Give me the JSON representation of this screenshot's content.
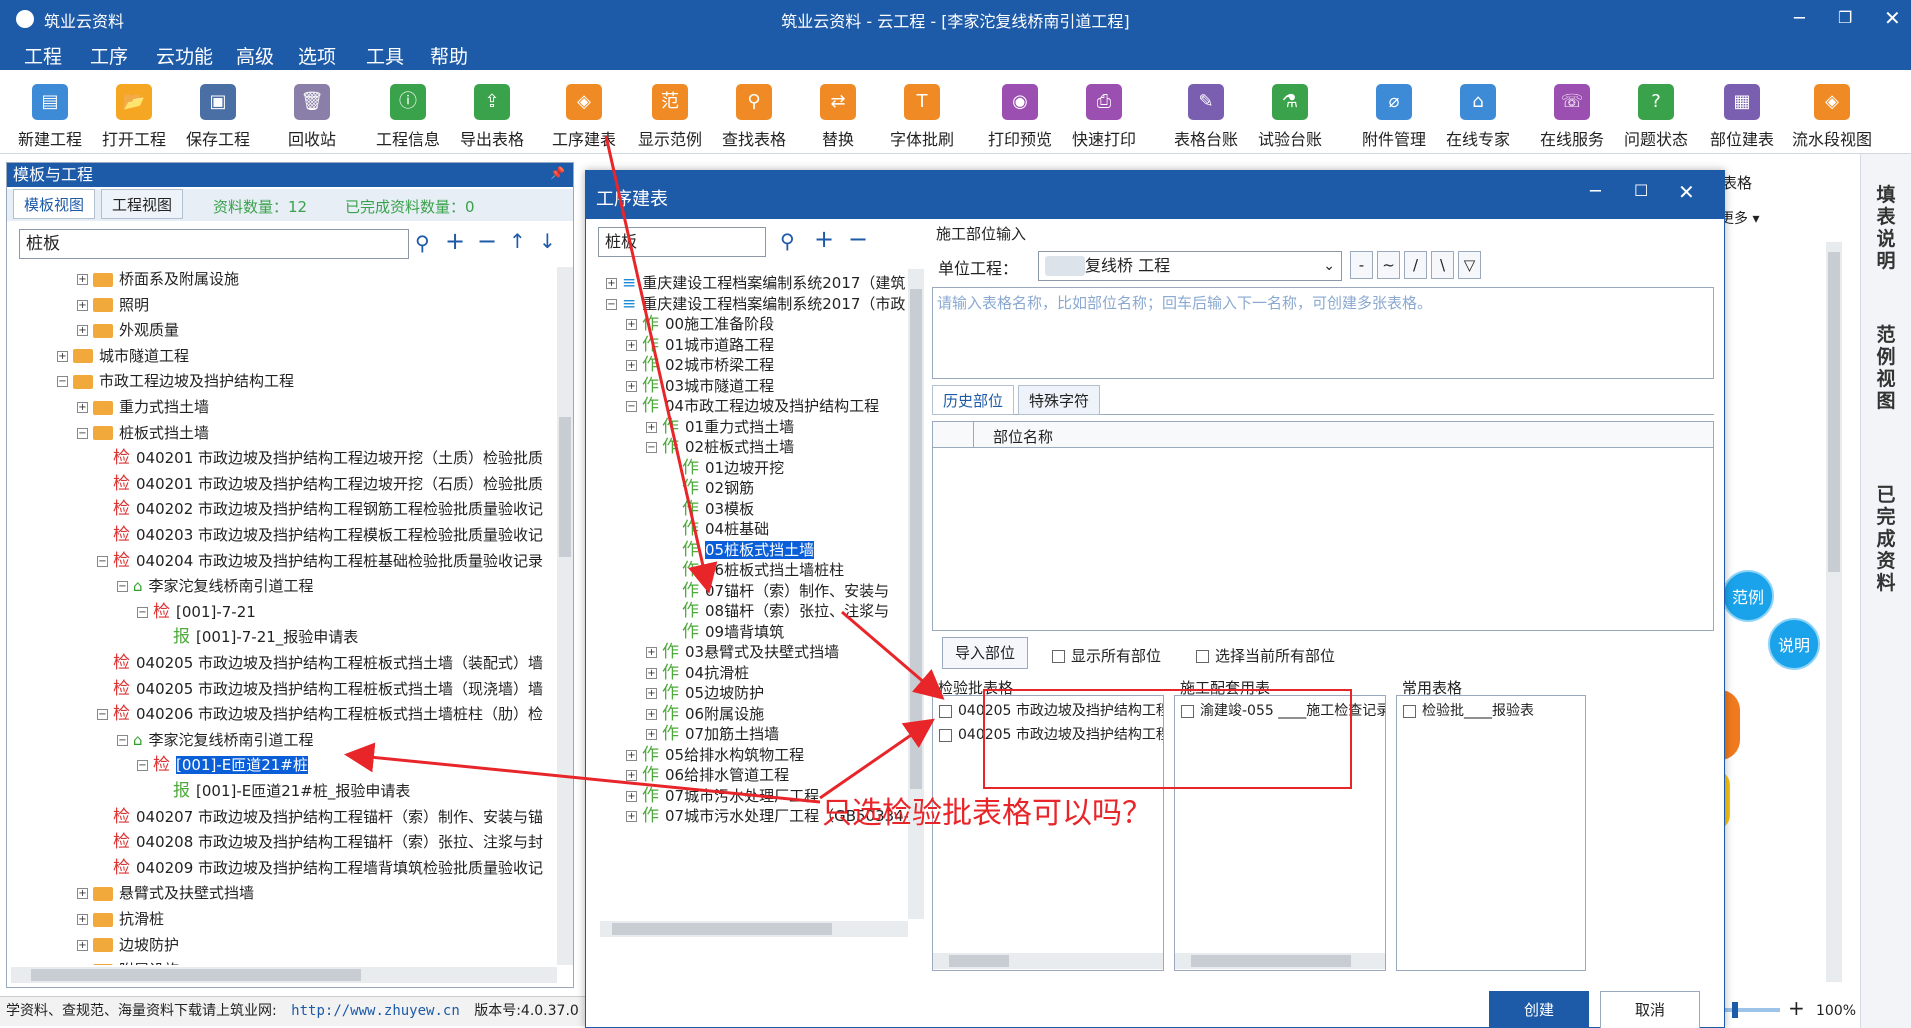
{
  "window": {
    "app_name": "筑业云资料",
    "title": "筑业云资料 - 云工程 - [李家沱复线桥南引道工程]"
  },
  "menu": [
    "工程",
    "工序",
    "云功能",
    "高级",
    "选项",
    "工具",
    "帮助"
  ],
  "toolbar": [
    {
      "label": "新建工程",
      "icon": "new-doc-icon",
      "color": "#3d8ad6"
    },
    {
      "label": "打开工程",
      "icon": "folder-open-icon",
      "color": "#f5a623"
    },
    {
      "label": "保存工程",
      "icon": "save-icon",
      "color": "#4a6fa5"
    },
    {
      "label": "回收站",
      "icon": "trash-icon",
      "color": "#8a7fa8"
    },
    {
      "label": "工程信息",
      "icon": "info-icon",
      "color": "#3aa24a"
    },
    {
      "label": "导出表格",
      "icon": "export-icon",
      "color": "#3aa24a"
    },
    {
      "label": "工序建表",
      "icon": "layers-icon",
      "color": "#f08a24"
    },
    {
      "label": "显示范例",
      "icon": "example-icon",
      "color": "#f08a24"
    },
    {
      "label": "查找表格",
      "icon": "search-icon",
      "color": "#f08a24"
    },
    {
      "label": "替换",
      "icon": "replace-icon",
      "color": "#f08a24"
    },
    {
      "label": "字体批刷",
      "icon": "font-brush-icon",
      "color": "#f08a24"
    },
    {
      "label": "打印预览",
      "icon": "eye-icon",
      "color": "#9b4fb0"
    },
    {
      "label": "快速打印",
      "icon": "printer-icon",
      "color": "#9b4fb0"
    },
    {
      "label": "表格台账",
      "icon": "ledger-icon",
      "color": "#7a5fb0"
    },
    {
      "label": "试验台账",
      "icon": "test-ledger-icon",
      "color": "#3aa24a"
    },
    {
      "label": "附件管理",
      "icon": "paperclip-icon",
      "color": "#3d8ad6"
    },
    {
      "label": "在线专家",
      "icon": "expert-icon",
      "color": "#3d8ad6"
    },
    {
      "label": "在线服务",
      "icon": "service-icon",
      "color": "#9b4fb0"
    },
    {
      "label": "问题状态",
      "icon": "question-icon",
      "color": "#3aa24a"
    },
    {
      "label": "部位建表",
      "icon": "grid-icon",
      "color": "#7a5fb0"
    },
    {
      "label": "流水段视图",
      "icon": "flow-icon",
      "color": "#f08a24"
    }
  ],
  "left_panel": {
    "title": "模板与工程",
    "tabs": [
      "模板视图",
      "工程视图"
    ],
    "count_label": "资料数量：12",
    "done_label": "已完成资料数量：0",
    "search_value": "桩板",
    "tree": [
      {
        "indent": 3,
        "pm": "+",
        "kind": "folder",
        "text": "桥面系及附属设施"
      },
      {
        "indent": 3,
        "pm": "+",
        "kind": "folder",
        "text": "照明"
      },
      {
        "indent": 3,
        "pm": "+",
        "kind": "folder",
        "text": "外观质量"
      },
      {
        "indent": 2,
        "pm": "+",
        "kind": "folder",
        "text": "城市隧道工程"
      },
      {
        "indent": 2,
        "pm": "-",
        "kind": "folder",
        "text": "市政工程边坡及挡护结构工程"
      },
      {
        "indent": 3,
        "pm": "+",
        "kind": "folder",
        "text": "重力式挡土墙"
      },
      {
        "indent": 3,
        "pm": "-",
        "kind": "folder",
        "text": "桩板式挡土墙"
      },
      {
        "indent": 4,
        "pm": "",
        "kind": "jian",
        "text": "040201 市政边坡及挡护结构工程边坡开挖（土质）检验批质"
      },
      {
        "indent": 4,
        "pm": "",
        "kind": "jian",
        "text": "040201 市政边坡及挡护结构工程边坡开挖（石质）检验批质"
      },
      {
        "indent": 4,
        "pm": "",
        "kind": "jian",
        "text": "040202 市政边坡及挡护结构工程钢筋工程检验批质量验收记"
      },
      {
        "indent": 4,
        "pm": "",
        "kind": "jian",
        "text": "040203 市政边坡及挡护结构工程模板工程检验批质量验收记"
      },
      {
        "indent": 4,
        "pm": "-",
        "kind": "jian",
        "text": "040204 市政边坡及挡护结构工程桩基础检验批质量验收记录"
      },
      {
        "indent": 5,
        "pm": "-",
        "kind": "house",
        "text": "李家沱复线桥南引道工程"
      },
      {
        "indent": 6,
        "pm": "-",
        "kind": "jian",
        "text": "[001]-7-21"
      },
      {
        "indent": 7,
        "pm": "",
        "kind": "bao",
        "text": "[001]-7-21_报验申请表"
      },
      {
        "indent": 4,
        "pm": "",
        "kind": "jian",
        "text": "040205 市政边坡及挡护结构工程桩板式挡土墙（装配式）墙"
      },
      {
        "indent": 4,
        "pm": "",
        "kind": "jian",
        "text": "040205 市政边坡及挡护结构工程桩板式挡土墙（现浇墙）墙"
      },
      {
        "indent": 4,
        "pm": "-",
        "kind": "jian",
        "text": "040206 市政边坡及挡护结构工程桩板式挡土墙桩柱（肋）检"
      },
      {
        "indent": 5,
        "pm": "-",
        "kind": "house",
        "text": "李家沱复线桥南引道工程"
      },
      {
        "indent": 6,
        "pm": "-",
        "kind": "jian",
        "text": "[001]-E匝道21#桩",
        "selected": true
      },
      {
        "indent": 7,
        "pm": "",
        "kind": "bao",
        "text": "[001]-E匝道21#桩_报验申请表"
      },
      {
        "indent": 4,
        "pm": "",
        "kind": "jian",
        "text": "040207 市政边坡及挡护结构工程锚杆（索）制作、安装与锚"
      },
      {
        "indent": 4,
        "pm": "",
        "kind": "jian",
        "text": "040208 市政边坡及挡护结构工程锚杆（索）张拉、注浆与封"
      },
      {
        "indent": 4,
        "pm": "",
        "kind": "jian",
        "text": "040209 市政边坡及挡护结构工程墙背填筑检验批质量验收记"
      },
      {
        "indent": 3,
        "pm": "+",
        "kind": "folder",
        "text": "悬臂式及扶壁式挡墙"
      },
      {
        "indent": 3,
        "pm": "+",
        "kind": "folder",
        "text": "抗滑桩"
      },
      {
        "indent": 3,
        "pm": "+",
        "kind": "folder",
        "text": "边坡防护"
      },
      {
        "indent": 3,
        "pm": "+",
        "kind": "folder",
        "text": "附属设施"
      }
    ]
  },
  "status_bar": {
    "text": "学资料、查规范、海量资料下载请上筑业网:",
    "url": "http://www.zhuyew.cn",
    "version": "版本号:4.0.37.0"
  },
  "dialog": {
    "title": "工序建表",
    "search_value": "桩板",
    "tree": [
      {
        "indent": 0,
        "pm": "+",
        "kind": "db",
        "text": "重庆建设工程档案编制系统2017（建筑"
      },
      {
        "indent": 0,
        "pm": "-",
        "kind": "db",
        "text": "重庆建设工程档案编制系统2017（市政"
      },
      {
        "indent": 1,
        "pm": "+",
        "kind": "zuo",
        "text": "00施工准备阶段"
      },
      {
        "indent": 1,
        "pm": "+",
        "kind": "zuo",
        "text": "01城市道路工程"
      },
      {
        "indent": 1,
        "pm": "+",
        "kind": "zuo",
        "text": "02城市桥梁工程"
      },
      {
        "indent": 1,
        "pm": "+",
        "kind": "zuo",
        "text": "03城市隧道工程"
      },
      {
        "indent": 1,
        "pm": "-",
        "kind": "zuo",
        "text": "04市政工程边坡及挡护结构工程"
      },
      {
        "indent": 2,
        "pm": "+",
        "kind": "zuo",
        "text": "01重力式挡土墙"
      },
      {
        "indent": 2,
        "pm": "-",
        "kind": "zuo",
        "text": "02桩板式挡土墙"
      },
      {
        "indent": 3,
        "pm": "",
        "kind": "zuo",
        "text": "01边坡开挖"
      },
      {
        "indent": 3,
        "pm": "",
        "kind": "zuo",
        "text": "02钢筋"
      },
      {
        "indent": 3,
        "pm": "",
        "kind": "zuo",
        "text": "03模板"
      },
      {
        "indent": 3,
        "pm": "",
        "kind": "zuo",
        "text": "04桩基础"
      },
      {
        "indent": 3,
        "pm": "",
        "kind": "zuo",
        "text": "05桩板式挡土墙",
        "selected": true
      },
      {
        "indent": 3,
        "pm": "",
        "kind": "zuo",
        "text": "06桩板式挡土墙桩柱"
      },
      {
        "indent": 3,
        "pm": "",
        "kind": "zuo",
        "text": "07锚杆（索）制作、安装与"
      },
      {
        "indent": 3,
        "pm": "",
        "kind": "zuo",
        "text": "08锚杆（索）张拉、注浆与"
      },
      {
        "indent": 3,
        "pm": "",
        "kind": "zuo",
        "text": "09墙背填筑"
      },
      {
        "indent": 2,
        "pm": "+",
        "kind": "zuo",
        "text": "03悬臂式及扶壁式挡墙"
      },
      {
        "indent": 2,
        "pm": "+",
        "kind": "zuo",
        "text": "04抗滑桩"
      },
      {
        "indent": 2,
        "pm": "+",
        "kind": "zuo",
        "text": "05边坡防护"
      },
      {
        "indent": 2,
        "pm": "+",
        "kind": "zuo",
        "text": "06附属设施"
      },
      {
        "indent": 2,
        "pm": "+",
        "kind": "zuo",
        "text": "07加筋土挡墙"
      },
      {
        "indent": 1,
        "pm": "+",
        "kind": "zuo",
        "text": "05给排水构筑物工程"
      },
      {
        "indent": 1,
        "pm": "+",
        "kind": "zuo",
        "text": "06给排水管道工程"
      },
      {
        "indent": 1,
        "pm": "+",
        "kind": "zuo",
        "text": "07城市污水处理厂工程"
      },
      {
        "indent": 1,
        "pm": "+",
        "kind": "zuo",
        "text": "07城市污水处理厂工程（GB50334-2"
      }
    ],
    "location_group": "施工部位输入",
    "unit_label": "单位工程：",
    "unit_value": "复线桥   工程",
    "sym_buttons": [
      "-",
      "~",
      "/",
      "\\",
      "▽"
    ],
    "textarea_placeholder": "请输入表格名称，比如部位名称；回车后输入下一名称，可创建多张表格。",
    "tabs": [
      "历史部位",
      "特殊字符"
    ],
    "grid_header": "部位名称",
    "import_button": "导入部位",
    "show_all_label": "显示所有部位",
    "select_all_label": "选择当前所有部位",
    "inspection_group": "检验批表格",
    "inspection_items": [
      "040205 市政边坡及挡护结构工程桩",
      "040205 市政边坡及挡护结构工程桩"
    ],
    "matching_group": "施工配套用表",
    "matching_items": [
      "渝建竣-055 ____施工检查记录（j"
    ],
    "common_group": "常用表格",
    "common_items": [
      "检验批____报验表"
    ],
    "create_button": "创建",
    "cancel_button": "取消"
  },
  "annotation": {
    "text": "只选检验批表格可以吗？",
    "color": "#e8262a"
  },
  "right_side": {
    "partial_label_1": "表格",
    "partial_label_2": "更多 ▾",
    "bubble_1": "范例",
    "bubble_2": "说明",
    "vertical_tabs": [
      "填表说明",
      "范例视图",
      "已完成资料"
    ],
    "zoom": "100%"
  }
}
